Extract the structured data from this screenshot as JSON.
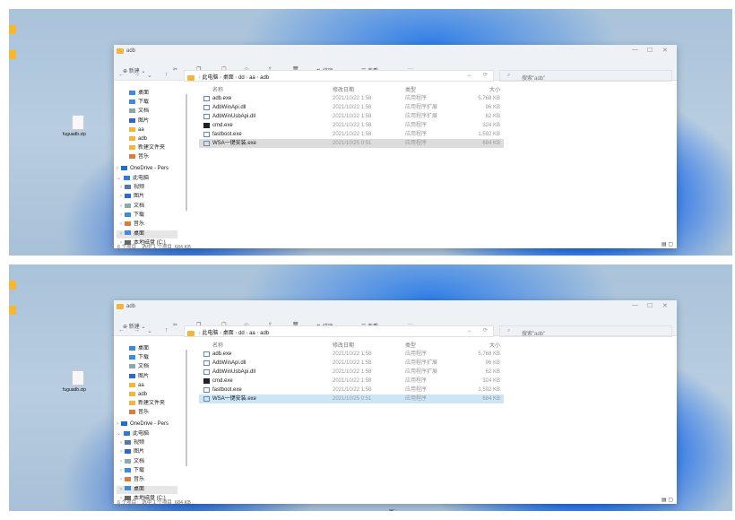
{
  "desktop": {
    "file_label": "fuguadb.zip"
  },
  "window": {
    "title": "adb",
    "controls": {
      "minimize": "—",
      "maximize": "☐",
      "close": "✕"
    },
    "toolbar": {
      "new_label": "新建",
      "sort_label": "排序",
      "view_label": "查看",
      "more_label": "···"
    },
    "breadcrumb": [
      "此电脑",
      "桌面",
      "dd",
      "aa",
      "adb"
    ],
    "search_placeholder": "搜索\"adb\"",
    "columns": {
      "name": "名称",
      "date": "修改日期",
      "type": "类型",
      "size": "大小"
    },
    "files": [
      {
        "name": "adb.exe",
        "date": "2021/10/22 1:58",
        "type": "应用程序",
        "size": "5,768 KB",
        "icon": "exe"
      },
      {
        "name": "AdbWinApi.dll",
        "date": "2021/10/22 1:58",
        "type": "应用程序扩展",
        "size": "96 KB",
        "icon": "dll"
      },
      {
        "name": "AdbWinUsbApi.dll",
        "date": "2021/10/22 1:58",
        "type": "应用程序扩展",
        "size": "62 KB",
        "icon": "dll"
      },
      {
        "name": "cmd.exe",
        "date": "2021/10/22 1:58",
        "type": "应用程序",
        "size": "324 KB",
        "icon": "cmd"
      },
      {
        "name": "fastboot.exe",
        "date": "2021/10/22 1:58",
        "type": "应用程序",
        "size": "1,592 KB",
        "icon": "exe"
      },
      {
        "name": "WSA一键安装.exe",
        "date": "2021/10/25 0:51",
        "type": "应用程序",
        "size": "684 KB",
        "icon": "exe",
        "selected": true
      }
    ],
    "sidebar": [
      {
        "label": "桌面",
        "pinned": true,
        "color": "#3d8be0"
      },
      {
        "label": "下载",
        "pinned": true,
        "color": "#3d8be0"
      },
      {
        "label": "文档",
        "pinned": true,
        "color": "#8aa"
      },
      {
        "label": "图片",
        "pinned": true,
        "color": "#2a6ad0"
      },
      {
        "label": "aa",
        "color": "#f3b63a"
      },
      {
        "label": "adb",
        "color": "#f3b63a"
      },
      {
        "label": "新建文件夹",
        "color": "#f3b63a"
      },
      {
        "label": "音乐",
        "color": "#e07a3a"
      },
      {
        "label": "OneDrive - Pers",
        "color": "#1f6fd0",
        "expander": "›"
      },
      {
        "label": "此电脑",
        "color": "#2a7ae0",
        "expander": "⌄"
      },
      {
        "label": "视频",
        "color": "#5577aa",
        "expander": "›",
        "indent": true
      },
      {
        "label": "图片",
        "color": "#2a6ad0",
        "expander": "›",
        "indent": true
      },
      {
        "label": "文档",
        "color": "#8aa",
        "expander": "›",
        "indent": true
      },
      {
        "label": "下载",
        "color": "#3d8be0",
        "expander": "›",
        "indent": true
      },
      {
        "label": "音乐",
        "color": "#e07a3a",
        "expander": "›",
        "indent": true
      },
      {
        "label": "桌面",
        "color": "#3d8be0",
        "expander": "›",
        "indent": true,
        "selected": true
      },
      {
        "label": "本地磁盘 (C:)",
        "color": "#666",
        "expander": "›",
        "indent": true
      }
    ],
    "status": {
      "count": "6 个项目",
      "selected": "选中 1 个项目",
      "size": "684 KB"
    }
  },
  "selection_colors": {
    "top": "#dcdcdc",
    "bottom": "#cde6f7"
  }
}
